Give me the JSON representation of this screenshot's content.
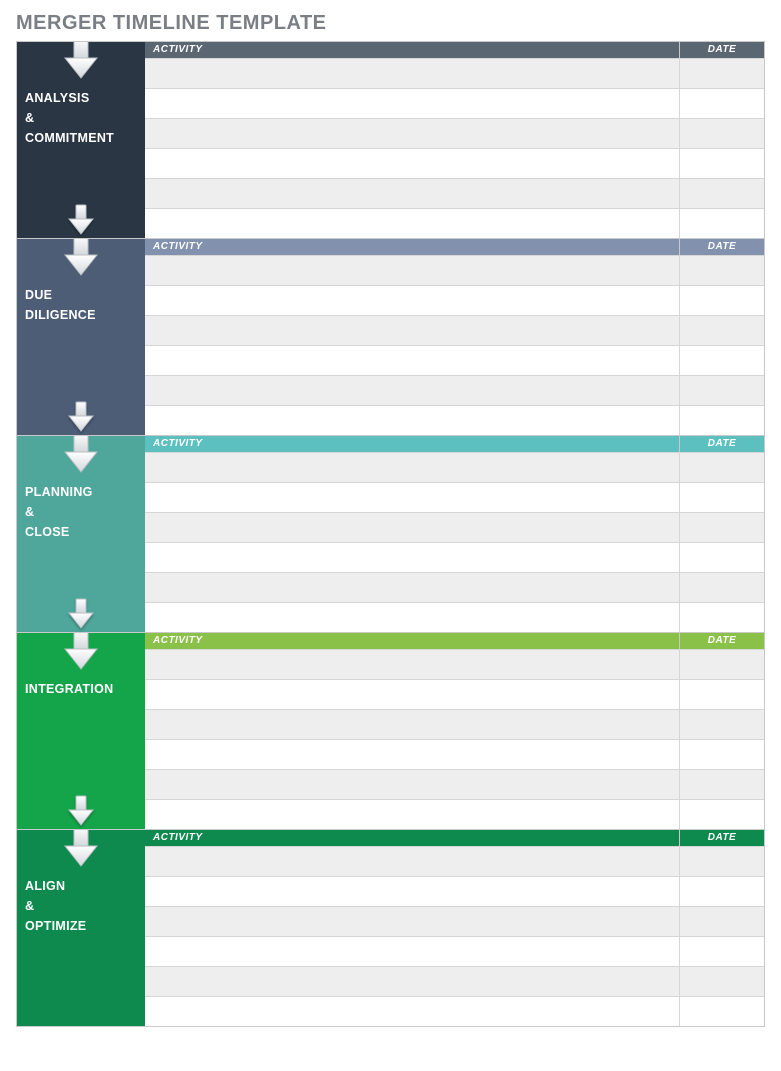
{
  "title": "MERGER TIMELINE TEMPLATE",
  "columns": {
    "activity": "ACTIVITY",
    "date": "DATE"
  },
  "sections": [
    {
      "id": "analysis",
      "label_lines": [
        "ANALYSIS",
        "&",
        "COMMITMENT"
      ],
      "phase_bg": "#2a3644",
      "header_bg": "#5b6673",
      "rows": [
        {
          "activity": "",
          "date": ""
        },
        {
          "activity": "",
          "date": ""
        },
        {
          "activity": "",
          "date": ""
        },
        {
          "activity": "",
          "date": ""
        },
        {
          "activity": "",
          "date": ""
        },
        {
          "activity": "",
          "date": ""
        }
      ]
    },
    {
      "id": "due-diligence",
      "label_lines": [
        "DUE",
        "DILIGENCE"
      ],
      "phase_bg": "#4c5d75",
      "header_bg": "#8292ae",
      "rows": [
        {
          "activity": "",
          "date": ""
        },
        {
          "activity": "",
          "date": ""
        },
        {
          "activity": "",
          "date": ""
        },
        {
          "activity": "",
          "date": ""
        },
        {
          "activity": "",
          "date": ""
        },
        {
          "activity": "",
          "date": ""
        }
      ]
    },
    {
      "id": "planning",
      "label_lines": [
        "PLANNING",
        "&",
        "CLOSE"
      ],
      "phase_bg": "#4fa69a",
      "header_bg": "#5dc0c0",
      "rows": [
        {
          "activity": "",
          "date": ""
        },
        {
          "activity": "",
          "date": ""
        },
        {
          "activity": "",
          "date": ""
        },
        {
          "activity": "",
          "date": ""
        },
        {
          "activity": "",
          "date": ""
        },
        {
          "activity": "",
          "date": ""
        }
      ]
    },
    {
      "id": "integration",
      "label_lines": [
        "INTEGRATION"
      ],
      "phase_bg": "#14a44a",
      "header_bg": "#8ac249",
      "rows": [
        {
          "activity": "",
          "date": ""
        },
        {
          "activity": "",
          "date": ""
        },
        {
          "activity": "",
          "date": ""
        },
        {
          "activity": "",
          "date": ""
        },
        {
          "activity": "",
          "date": ""
        },
        {
          "activity": "",
          "date": ""
        }
      ]
    },
    {
      "id": "align",
      "label_lines": [
        "ALIGN",
        "&",
        "OPTIMIZE"
      ],
      "phase_bg": "#0f8a4f",
      "header_bg": "#0f8a4f",
      "rows": [
        {
          "activity": "",
          "date": ""
        },
        {
          "activity": "",
          "date": ""
        },
        {
          "activity": "",
          "date": ""
        },
        {
          "activity": "",
          "date": ""
        },
        {
          "activity": "",
          "date": ""
        },
        {
          "activity": "",
          "date": ""
        }
      ]
    }
  ]
}
